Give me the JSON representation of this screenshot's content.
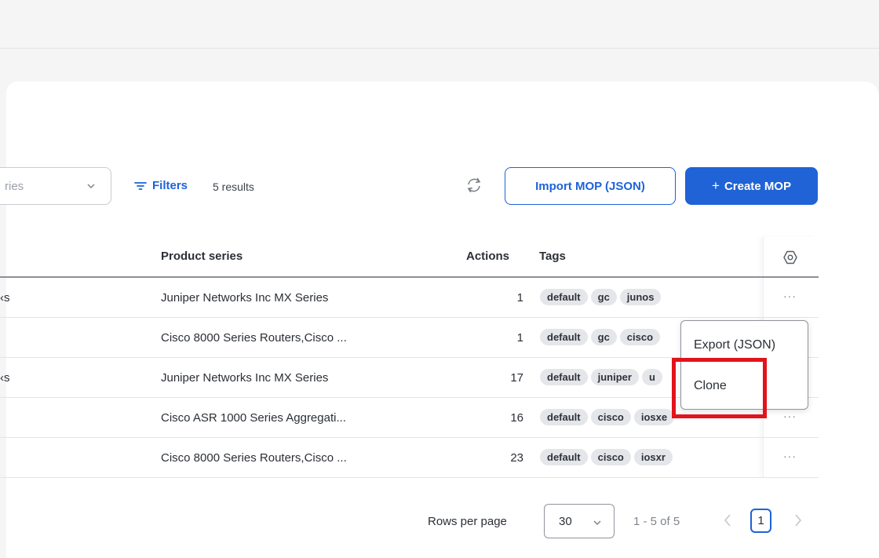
{
  "toolbar": {
    "select_text": "ries",
    "filters_label": "Filters",
    "results_count": "5 results",
    "import_button": "Import MOP (JSON)",
    "create_plus": "+",
    "create_button": "Create MOP"
  },
  "table": {
    "columns": {
      "product_series": "Product series",
      "actions": "Actions",
      "tags": "Tags"
    },
    "rows": [
      {
        "left_fragment": "‹s",
        "product_series": "Juniper Networks Inc MX Series",
        "actions": "1",
        "tags": [
          "default",
          "gc",
          "junos"
        ]
      },
      {
        "left_fragment": "",
        "product_series": "Cisco 8000 Series Routers,Cisco ...",
        "actions": "1",
        "tags": [
          "default",
          "gc",
          "cisco"
        ]
      },
      {
        "left_fragment": "‹s",
        "product_series": "Juniper Networks Inc MX Series",
        "actions": "17",
        "tags": [
          "default",
          "juniper",
          "u"
        ]
      },
      {
        "left_fragment": "",
        "product_series": "Cisco ASR 1000 Series Aggregati...",
        "actions": "16",
        "tags": [
          "default",
          "cisco",
          "iosxe"
        ]
      },
      {
        "left_fragment": "",
        "product_series": "Cisco 8000 Series Routers,Cisco ...",
        "actions": "23",
        "tags": [
          "default",
          "cisco",
          "iosxr"
        ]
      }
    ],
    "row_menu_glyph": "···"
  },
  "context_menu": {
    "items": [
      "Export (JSON)",
      "Clone"
    ]
  },
  "pagination": {
    "rows_per_page_label": "Rows per page",
    "rows_per_page_value": "30",
    "range_text": "1 - 5 of 5",
    "current_page": "1"
  },
  "colors": {
    "primary": "#1d63d8",
    "highlight": "#e2141b",
    "tag_bg": "#e4e6ea"
  }
}
